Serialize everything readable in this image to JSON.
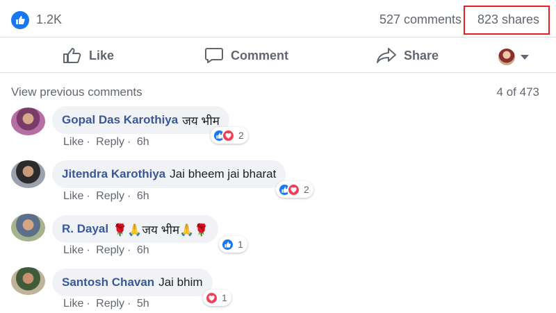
{
  "stats": {
    "likes": "1.2K",
    "comments": "527 comments",
    "shares": "823 shares"
  },
  "actions": {
    "like": "Like",
    "comment": "Comment",
    "share": "Share"
  },
  "thread": {
    "view_previous": "View previous comments",
    "count": "4 of 473"
  },
  "comments": [
    {
      "author": "Gopal Das Karothiya",
      "text": "जय भीम",
      "like": "Like",
      "reply": "Reply",
      "time": "6h",
      "reactions": [
        "like-icon",
        "love-icon"
      ],
      "reaction_count": "2"
    },
    {
      "author": "Jitendra Karothiya",
      "text": "Jai bheem jai bharat",
      "like": "Like",
      "reply": "Reply",
      "time": "6h",
      "reactions": [
        "like-icon",
        "love-icon"
      ],
      "reaction_count": "2"
    },
    {
      "author": "R. Dayal",
      "text": "🌹🙏जय भीम🙏🌹",
      "like": "Like",
      "reply": "Reply",
      "time": "6h",
      "reactions": [
        "like-icon"
      ],
      "reaction_count": "1"
    },
    {
      "author": "Santosh Chavan",
      "text": "Jai bhim",
      "like": "Like",
      "reply": "Reply",
      "time": "5h",
      "reactions": [
        "love-icon"
      ],
      "reaction_count": "1"
    }
  ],
  "colors": {
    "like_blue": "#1877f2",
    "love_red": "#f33e58",
    "author_blue": "#385898",
    "highlight_box": "#e41e25",
    "bubble_bg": "#f0f2f5"
  }
}
